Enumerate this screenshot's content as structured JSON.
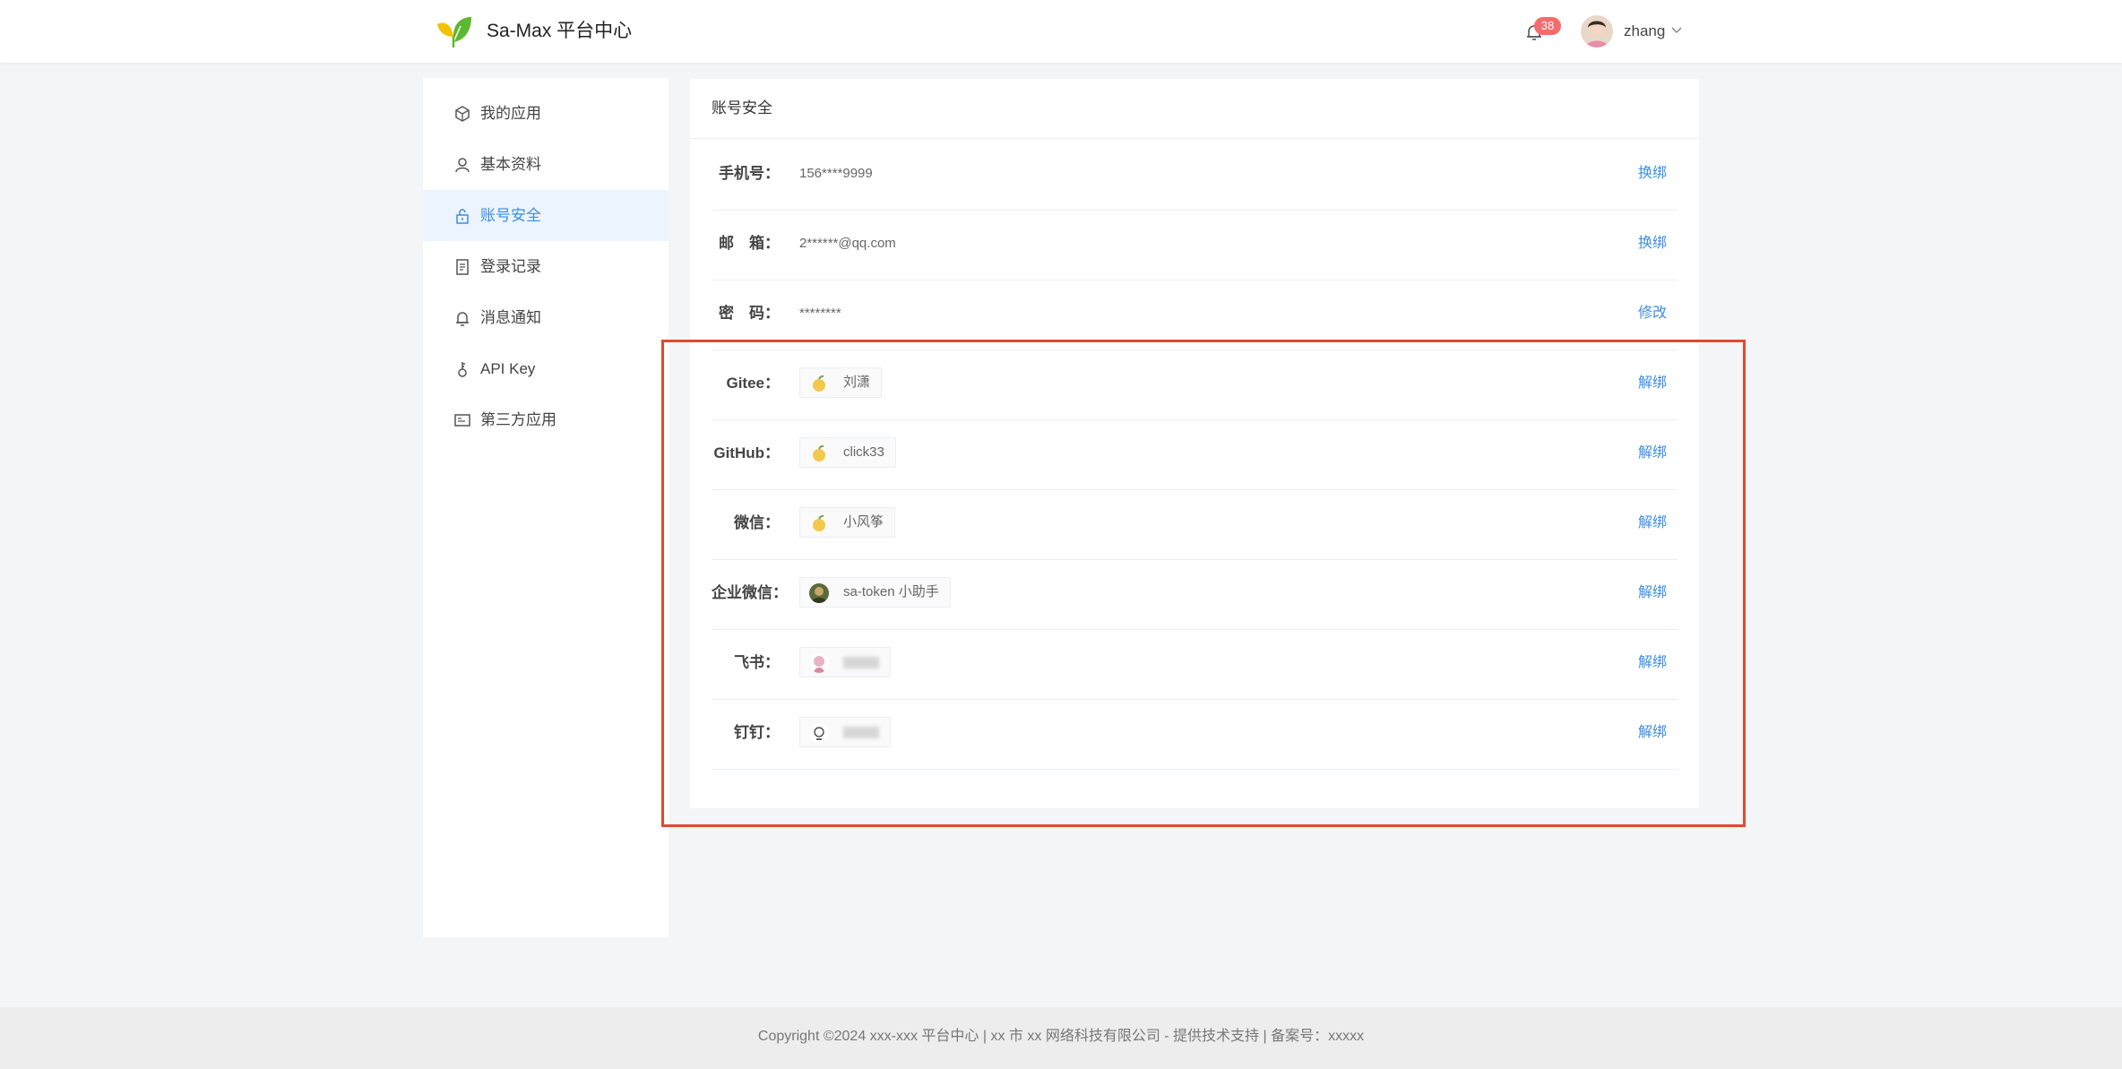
{
  "header": {
    "app_title": "Sa-Max 平台中心",
    "notification_count": "38",
    "username": "zhang"
  },
  "sidebar": {
    "items": [
      {
        "label": "我的应用",
        "icon": "app-cube-icon"
      },
      {
        "label": "基本资料",
        "icon": "user-icon"
      },
      {
        "label": "账号安全",
        "icon": "lock-icon",
        "active": true
      },
      {
        "label": "登录记录",
        "icon": "document-icon"
      },
      {
        "label": "消息通知",
        "icon": "bell-icon"
      },
      {
        "label": "API Key",
        "icon": "key-icon"
      },
      {
        "label": "第三方应用",
        "icon": "card-icon"
      }
    ]
  },
  "main": {
    "title": "账号安全",
    "rows": [
      {
        "label": "手机号：",
        "value": "156****9999",
        "action": "换绑"
      },
      {
        "label": "邮　箱：",
        "value": "2******@qq.com",
        "action": "换绑"
      },
      {
        "label": "密　码：",
        "value": "********",
        "action": "修改"
      },
      {
        "label": "Gitee：",
        "value": "刘潇",
        "action": "解绑"
      },
      {
        "label": "GitHub：",
        "value": "click33",
        "action": "解绑"
      },
      {
        "label": "微信：",
        "value": "小风筝",
        "action": "解绑"
      },
      {
        "label": "企业微信：",
        "value": "sa-token 小助手",
        "action": "解绑"
      },
      {
        "label": "飞书：",
        "value": "",
        "action": "解绑"
      },
      {
        "label": "钉钉：",
        "value": "",
        "action": "解绑"
      }
    ]
  },
  "footer": {
    "copyright": "Copyright ©2024 xxx-xxx 平台中心 | xx 市 xx 网络科技有限公司 - 提供技术支持 | 备案号：xxxxx"
  },
  "colors": {
    "accent": "#3a8ee6",
    "active_bg": "#ecf4ff",
    "badge": "#f56c6c",
    "highlight_border": "#e04a2f"
  }
}
